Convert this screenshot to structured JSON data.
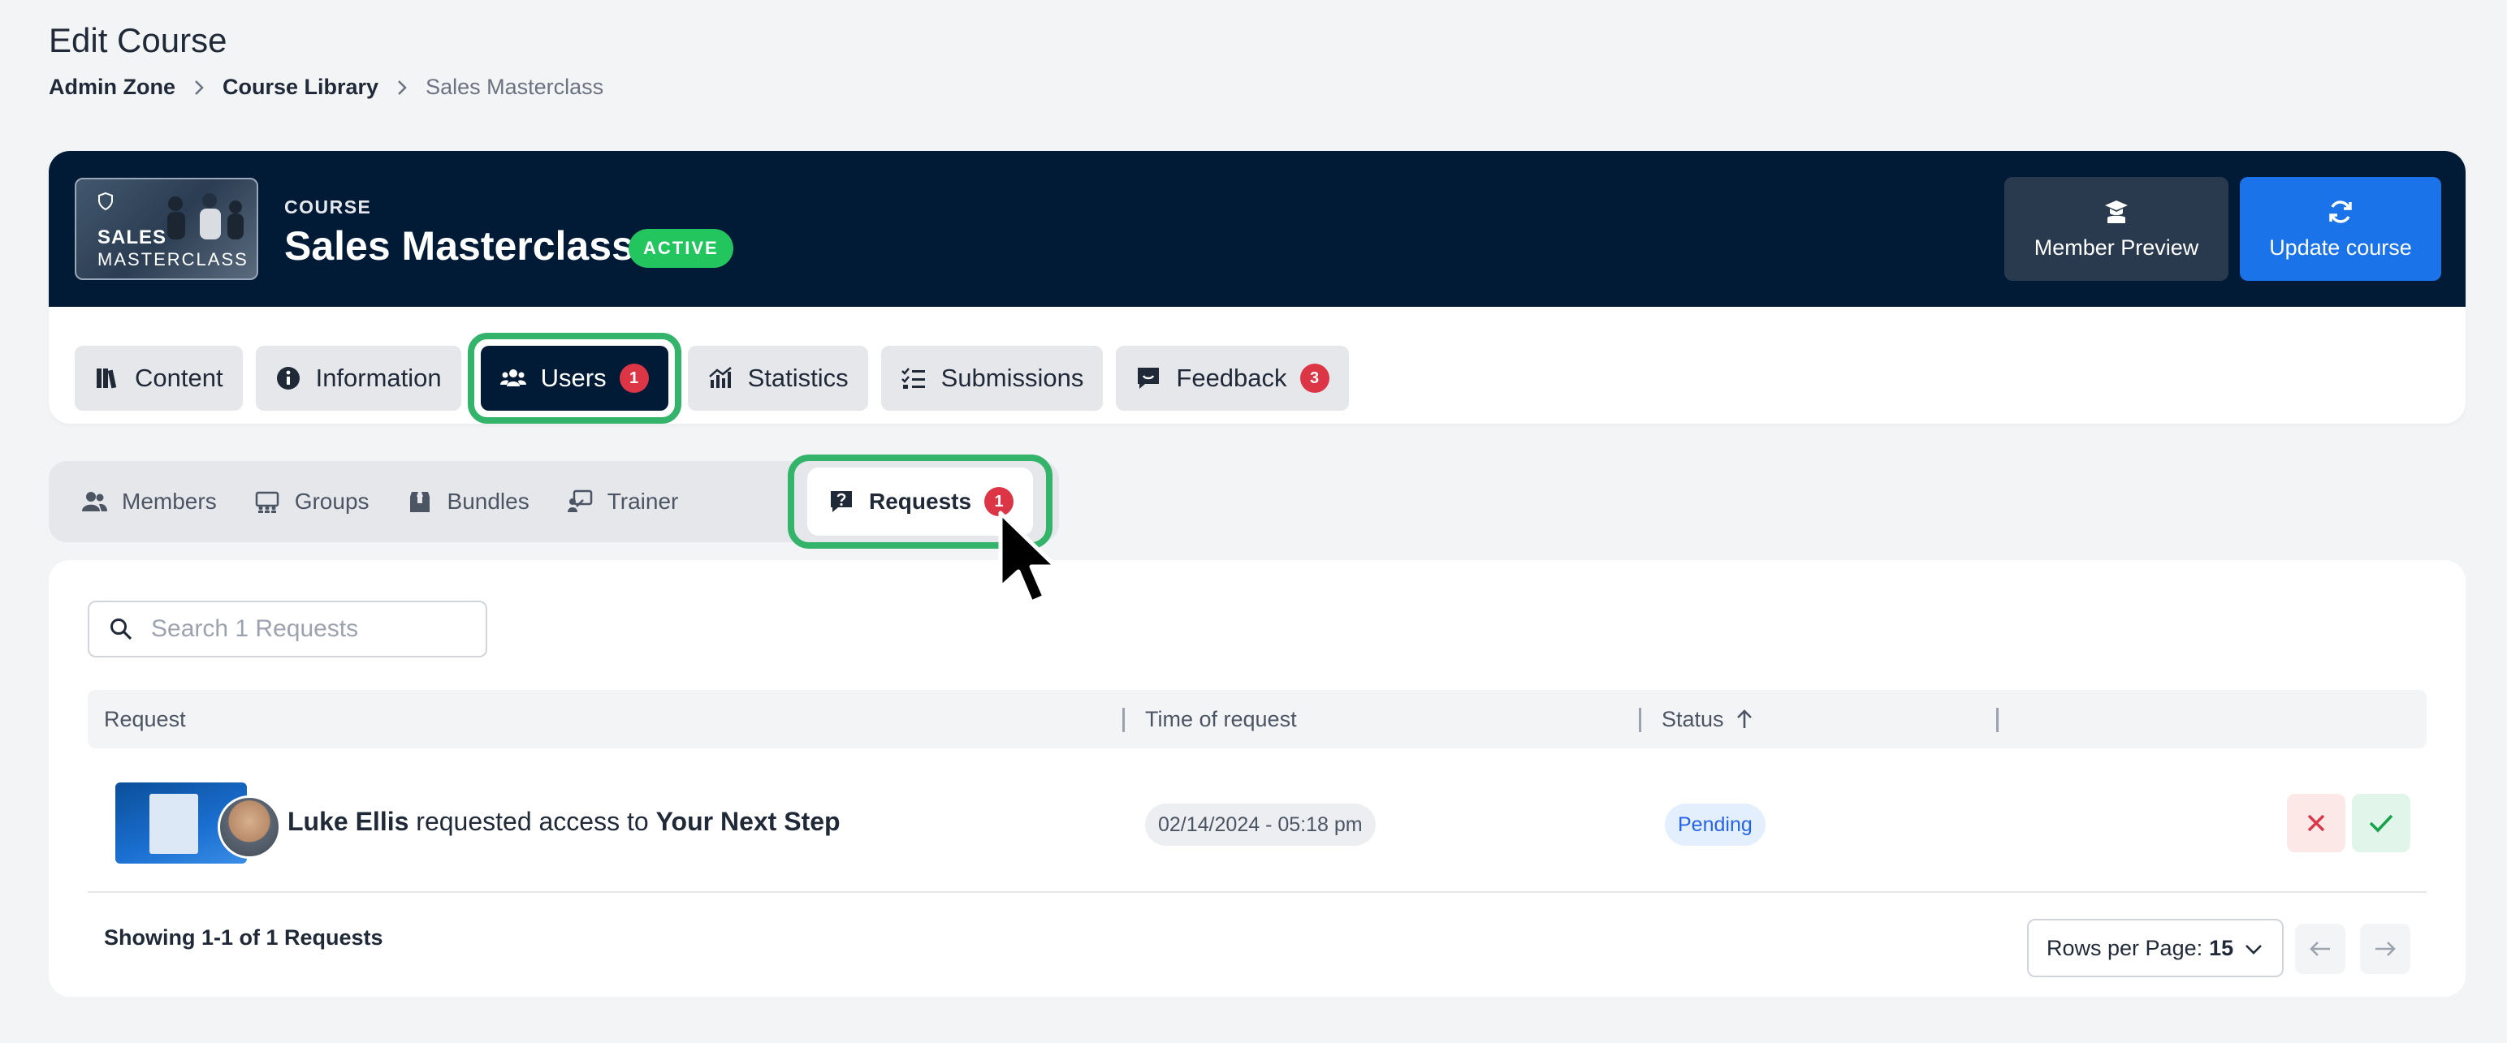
{
  "page": {
    "title": "Edit Course"
  },
  "breadcrumb": {
    "items": [
      "Admin Zone",
      "Course Library",
      "Sales Masterclass"
    ]
  },
  "course": {
    "kicker": "COURSE",
    "name": "Sales Masterclass",
    "status_badge": "ACTIVE",
    "thumb_line1": "SALES",
    "thumb_line2": "MASTERCLASS"
  },
  "header_buttons": {
    "preview_label": "Member Preview",
    "update_label": "Update course"
  },
  "main_tabs": [
    {
      "label": "Content"
    },
    {
      "label": "Information"
    },
    {
      "label": "Users",
      "badge": "1"
    },
    {
      "label": "Statistics"
    },
    {
      "label": "Submissions"
    },
    {
      "label": "Feedback",
      "badge": "3"
    }
  ],
  "sub_tabs": [
    {
      "label": "Members"
    },
    {
      "label": "Groups"
    },
    {
      "label": "Bundles"
    },
    {
      "label": "Trainer"
    },
    {
      "label": "Requests",
      "badge": "1"
    }
  ],
  "search": {
    "placeholder": "Search 1 Requests"
  },
  "table": {
    "columns": [
      "Request",
      "Time of request",
      "Status"
    ],
    "rows": [
      {
        "user": "Luke Ellis",
        "action": " requested access to ",
        "item": "Your Next Step",
        "time": "02/14/2024 - 05:18 pm",
        "status": "Pending"
      }
    ]
  },
  "footer": {
    "showing": "Showing 1-1 of 1 Requests",
    "rows_label": "Rows per Page:",
    "rows_value": "15"
  },
  "colors": {
    "navy": "#011b36",
    "primary_blue": "#1a73e8",
    "highlight_green": "#34b36b",
    "badge_red": "#dc3545",
    "active_green": "#22c55e"
  }
}
